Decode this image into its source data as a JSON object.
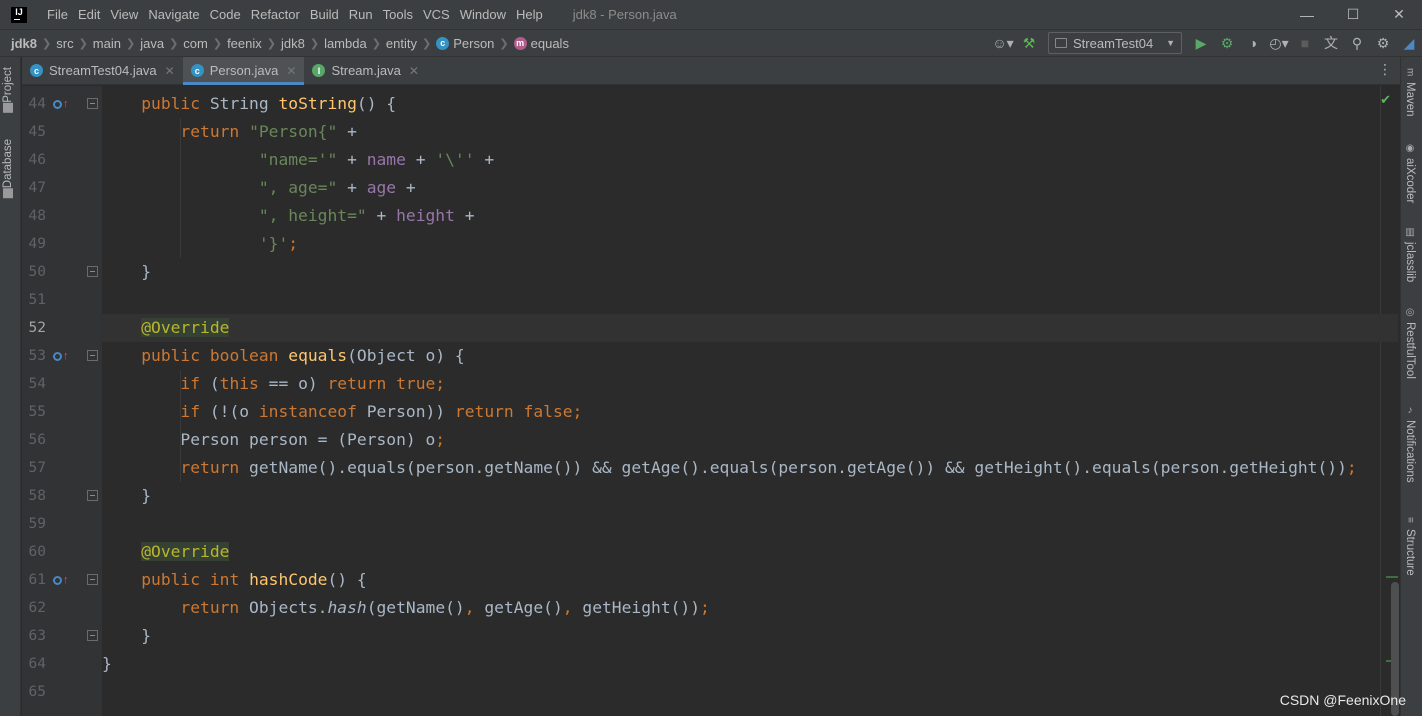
{
  "menu": {
    "items": [
      "File",
      "Edit",
      "View",
      "Navigate",
      "Code",
      "Refactor",
      "Build",
      "Run",
      "Tools",
      "VCS",
      "Window",
      "Help"
    ],
    "window_title": "jdk8 - Person.java"
  },
  "breadcrumbs": [
    "jdk8",
    "src",
    "main",
    "java",
    "com",
    "feenix",
    "jdk8",
    "lambda",
    "entity",
    "Person",
    "equals"
  ],
  "run_config": {
    "label": "StreamTest04"
  },
  "left_tools": [
    "Project",
    "Database"
  ],
  "right_tools": [
    "Maven",
    "aiXcoder",
    "jclasslib",
    "RestfulTool",
    "Notifications",
    "Structure"
  ],
  "tabs": [
    {
      "label": "StreamTest04.java",
      "icon": "class-icon",
      "active": false
    },
    {
      "label": "Person.java",
      "icon": "class-icon",
      "active": true
    },
    {
      "label": "Stream.java",
      "icon": "interface-icon",
      "active": false
    }
  ],
  "editor": {
    "line_numbers": [
      "44",
      "45",
      "46",
      "47",
      "48",
      "49",
      "50",
      "51",
      "52",
      "53",
      "54",
      "55",
      "56",
      "57",
      "58",
      "59",
      "60",
      "61",
      "62",
      "63",
      "64",
      "65"
    ],
    "current_line": "52"
  },
  "watermark": "CSDN @FeenixOne",
  "colors": {
    "keyword": "#cc7832",
    "string": "#6a8759",
    "field": "#9876aa",
    "method": "#ffc66d",
    "annotation": "#bbb529",
    "accent": "#4a88c7"
  }
}
